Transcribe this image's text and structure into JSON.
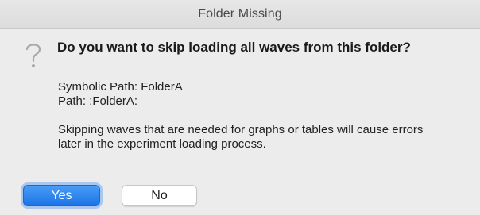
{
  "window": {
    "title": "Folder Missing"
  },
  "dialog": {
    "icon": "question-mark-icon",
    "heading": "Do you want to skip loading all waves from this folder?",
    "symbolic_path": "Symbolic Path: FolderA",
    "path": "Path: :FolderA:",
    "message_line1": "Skipping waves that are needed for graphs or tables will cause errors",
    "message_line2": "later in the experiment loading process."
  },
  "buttons": {
    "yes_label": "Yes",
    "no_label": "No"
  },
  "colors": {
    "accent": "#1c74e6",
    "background": "#ececec"
  }
}
